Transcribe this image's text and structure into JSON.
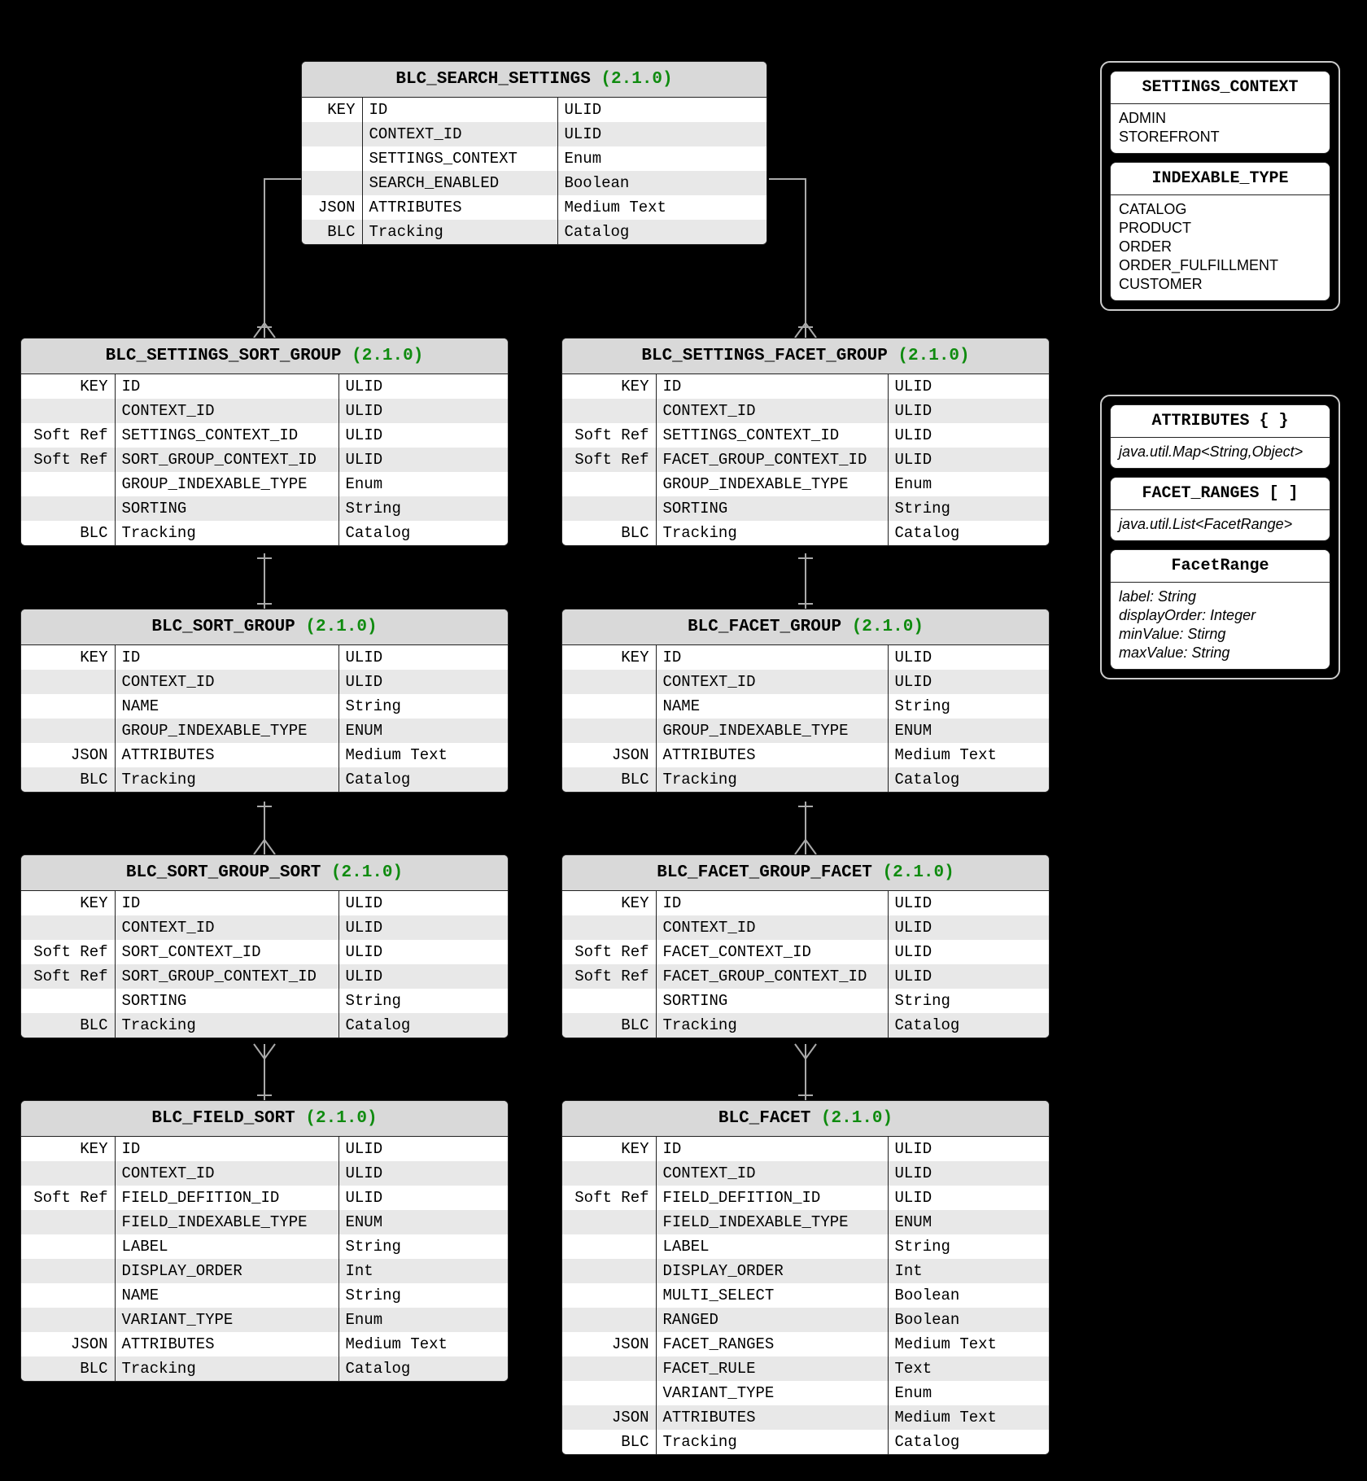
{
  "version": "(2.1.0)",
  "entities": {
    "search_settings": {
      "title": "BLC_SEARCH_SETTINGS",
      "rows": [
        {
          "k": "KEY",
          "n": "ID",
          "t": "ULID"
        },
        {
          "k": "",
          "n": "CONTEXT_ID",
          "t": "ULID"
        },
        {
          "k": "",
          "n": "SETTINGS_CONTEXT",
          "t": "Enum"
        },
        {
          "k": "",
          "n": "SEARCH_ENABLED",
          "t": "Boolean"
        },
        {
          "k": "JSON",
          "n": "ATTRIBUTES",
          "t": "Medium Text"
        },
        {
          "k": "BLC",
          "n": "Tracking",
          "t": "Catalog"
        }
      ]
    },
    "settings_sort_group": {
      "title": "BLC_SETTINGS_SORT_GROUP",
      "rows": [
        {
          "k": "KEY",
          "n": "ID",
          "t": "ULID"
        },
        {
          "k": "",
          "n": "CONTEXT_ID",
          "t": "ULID"
        },
        {
          "k": "Soft Ref",
          "n": "SETTINGS_CONTEXT_ID",
          "t": "ULID"
        },
        {
          "k": "Soft Ref",
          "n": "SORT_GROUP_CONTEXT_ID",
          "t": "ULID"
        },
        {
          "k": "",
          "n": "GROUP_INDEXABLE_TYPE",
          "t": "Enum"
        },
        {
          "k": "",
          "n": "SORTING",
          "t": "String"
        },
        {
          "k": "BLC",
          "n": "Tracking",
          "t": "Catalog"
        }
      ]
    },
    "settings_facet_group": {
      "title": "BLC_SETTINGS_FACET_GROUP",
      "rows": [
        {
          "k": "KEY",
          "n": "ID",
          "t": "ULID"
        },
        {
          "k": "",
          "n": "CONTEXT_ID",
          "t": "ULID"
        },
        {
          "k": "Soft Ref",
          "n": "SETTINGS_CONTEXT_ID",
          "t": "ULID"
        },
        {
          "k": "Soft Ref",
          "n": "FACET_GROUP_CONTEXT_ID",
          "t": "ULID"
        },
        {
          "k": "",
          "n": "GROUP_INDEXABLE_TYPE",
          "t": "Enum"
        },
        {
          "k": "",
          "n": "SORTING",
          "t": "String"
        },
        {
          "k": "BLC",
          "n": "Tracking",
          "t": "Catalog"
        }
      ]
    },
    "sort_group": {
      "title": "BLC_SORT_GROUP",
      "rows": [
        {
          "k": "KEY",
          "n": "ID",
          "t": "ULID"
        },
        {
          "k": "",
          "n": "CONTEXT_ID",
          "t": "ULID"
        },
        {
          "k": "",
          "n": "NAME",
          "t": "String"
        },
        {
          "k": "",
          "n": "GROUP_INDEXABLE_TYPE",
          "t": "ENUM"
        },
        {
          "k": "JSON",
          "n": "ATTRIBUTES",
          "t": "Medium Text"
        },
        {
          "k": "BLC",
          "n": "Tracking",
          "t": "Catalog"
        }
      ]
    },
    "facet_group": {
      "title": "BLC_FACET_GROUP",
      "rows": [
        {
          "k": "KEY",
          "n": "ID",
          "t": "ULID"
        },
        {
          "k": "",
          "n": "CONTEXT_ID",
          "t": "ULID"
        },
        {
          "k": "",
          "n": "NAME",
          "t": "String"
        },
        {
          "k": "",
          "n": "GROUP_INDEXABLE_TYPE",
          "t": "ENUM"
        },
        {
          "k": "JSON",
          "n": "ATTRIBUTES",
          "t": "Medium Text"
        },
        {
          "k": "BLC",
          "n": "Tracking",
          "t": "Catalog"
        }
      ]
    },
    "sort_group_sort": {
      "title": "BLC_SORT_GROUP_SORT",
      "rows": [
        {
          "k": "KEY",
          "n": "ID",
          "t": "ULID"
        },
        {
          "k": "",
          "n": "CONTEXT_ID",
          "t": "ULID"
        },
        {
          "k": "Soft Ref",
          "n": "SORT_CONTEXT_ID",
          "t": "ULID"
        },
        {
          "k": "Soft Ref",
          "n": "SORT_GROUP_CONTEXT_ID",
          "t": "ULID"
        },
        {
          "k": "",
          "n": "SORTING",
          "t": "String"
        },
        {
          "k": "BLC",
          "n": "Tracking",
          "t": "Catalog"
        }
      ]
    },
    "facet_group_facet": {
      "title": "BLC_FACET_GROUP_FACET",
      "rows": [
        {
          "k": "KEY",
          "n": "ID",
          "t": "ULID"
        },
        {
          "k": "",
          "n": "CONTEXT_ID",
          "t": "ULID"
        },
        {
          "k": "Soft Ref",
          "n": "FACET_CONTEXT_ID",
          "t": "ULID"
        },
        {
          "k": "Soft Ref",
          "n": "FACET_GROUP_CONTEXT_ID",
          "t": "ULID"
        },
        {
          "k": "",
          "n": "SORTING",
          "t": "String"
        },
        {
          "k": "BLC",
          "n": "Tracking",
          "t": "Catalog"
        }
      ]
    },
    "field_sort": {
      "title": "BLC_FIELD_SORT",
      "rows": [
        {
          "k": "KEY",
          "n": "ID",
          "t": "ULID"
        },
        {
          "k": "",
          "n": "CONTEXT_ID",
          "t": "ULID"
        },
        {
          "k": "Soft Ref",
          "n": "FIELD_DEFITION_ID",
          "t": "ULID"
        },
        {
          "k": "",
          "n": "FIELD_INDEXABLE_TYPE",
          "t": "ENUM"
        },
        {
          "k": "",
          "n": "LABEL",
          "t": "String"
        },
        {
          "k": "",
          "n": "DISPLAY_ORDER",
          "t": "Int"
        },
        {
          "k": "",
          "n": "NAME",
          "t": "String"
        },
        {
          "k": "",
          "n": "VARIANT_TYPE",
          "t": "Enum"
        },
        {
          "k": "JSON",
          "n": "ATTRIBUTES",
          "t": "Medium Text"
        },
        {
          "k": "BLC",
          "n": "Tracking",
          "t": "Catalog"
        }
      ]
    },
    "facet": {
      "title": "BLC_FACET",
      "rows": [
        {
          "k": "KEY",
          "n": "ID",
          "t": "ULID"
        },
        {
          "k": "",
          "n": "CONTEXT_ID",
          "t": "ULID"
        },
        {
          "k": "Soft Ref",
          "n": "FIELD_DEFITION_ID",
          "t": "ULID"
        },
        {
          "k": "",
          "n": "FIELD_INDEXABLE_TYPE",
          "t": "ENUM"
        },
        {
          "k": "",
          "n": "LABEL",
          "t": "String"
        },
        {
          "k": "",
          "n": "DISPLAY_ORDER",
          "t": "Int"
        },
        {
          "k": "",
          "n": "MULTI_SELECT",
          "t": "Boolean"
        },
        {
          "k": "",
          "n": "RANGED",
          "t": "Boolean"
        },
        {
          "k": "JSON",
          "n": "FACET_RANGES",
          "t": "Medium Text"
        },
        {
          "k": "",
          "n": "FACET_RULE",
          "t": "Text"
        },
        {
          "k": "",
          "n": "VARIANT_TYPE",
          "t": "Enum"
        },
        {
          "k": "JSON",
          "n": "ATTRIBUTES",
          "t": "Medium Text"
        },
        {
          "k": "BLC",
          "n": "Tracking",
          "t": "Catalog"
        }
      ]
    }
  },
  "side": {
    "settings_context": {
      "title": "SETTINGS_CONTEXT",
      "lines": [
        "ADMIN",
        "STOREFRONT"
      ]
    },
    "indexable_type": {
      "title": "INDEXABLE_TYPE",
      "lines": [
        "CATALOG",
        "PRODUCT",
        "ORDER",
        "ORDER_FULFILLMENT",
        "CUSTOMER"
      ]
    },
    "attributes": {
      "title": "ATTRIBUTES { }",
      "body": "java.util.Map<String,Object>"
    },
    "facet_ranges": {
      "title": "FACET_RANGES [ ]",
      "body": "java.util.List<FacetRange>"
    },
    "facet_range": {
      "title": "FacetRange",
      "lines": [
        "label: String",
        "displayOrder: Integer",
        "minValue: Stirng",
        "maxValue: String"
      ]
    }
  }
}
